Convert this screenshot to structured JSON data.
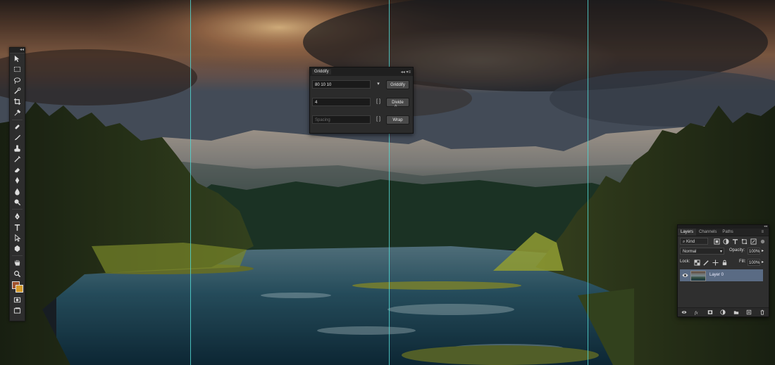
{
  "tools_panel": {
    "collapse_glyph": "◂◂",
    "tools": [
      "move-tool-icon",
      "marquee-tool-icon",
      "lasso-tool-icon",
      "quick-selection-icon",
      "crop-tool-icon",
      "eyedropper-icon",
      "healing-brush-icon",
      "brush-tool-icon",
      "clone-stamp-icon",
      "history-brush-icon",
      "eraser-icon",
      "gradient-icon",
      "blur-icon",
      "dodge-icon",
      "pen-tool-icon",
      "type-tool-icon",
      "path-selection-icon",
      "shape-tool-icon",
      "hand-tool-icon",
      "zoom-tool-icon"
    ],
    "foreground_color": "#a0522d",
    "background_color": "#d49a2a"
  },
  "griddify": {
    "title": "Griddify",
    "collapse_glyph": "◂◂",
    "menu_glyph": "▾≡",
    "grid_value": "80 10 10",
    "grid_button": "Griddify",
    "divide_value": "4",
    "divide_button": "Divide",
    "spacing_placeholder": "Spacing",
    "wrap_button": "Wrap",
    "bracket_glyph": "[ ]",
    "dropdown_glyph": "▾"
  },
  "layers_panel": {
    "collapse_glyph": "◂◂",
    "tabs": [
      "Layers",
      "Channels",
      "Paths"
    ],
    "filter_kind": "Kind",
    "blend_mode": "Normal",
    "opacity_label": "Opacity:",
    "opacity_value": "100%",
    "lock_label": "Lock:",
    "fill_label": "Fill:",
    "fill_value": "100%",
    "layer_name": "Layer 0",
    "menu_glyph": "≡",
    "arrow_glyph": "▸"
  },
  "colors": {
    "guide": "#52d6d1",
    "panel_bg": "#2b2b2b",
    "selected_layer": "#5a6b84"
  }
}
